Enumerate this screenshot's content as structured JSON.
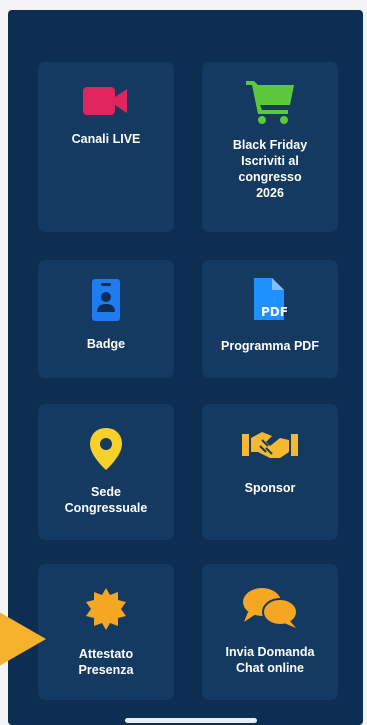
{
  "tiles": [
    {
      "label": "Canali LIVE",
      "icon": "video-camera-icon",
      "color": "#e0245e"
    },
    {
      "label": "Black Friday\nIscriviti al\ncongresso\n2026",
      "icon": "shopping-cart-icon",
      "color": "#5cc93a"
    },
    {
      "label": "Badge",
      "icon": "id-badge-icon",
      "color": "#1e7bf0"
    },
    {
      "label": "Programma PDF",
      "icon": "pdf-file-icon",
      "color": "#1e90ff"
    },
    {
      "label": "Sede\nCongressuale",
      "icon": "map-pin-icon",
      "color": "#f7d12a"
    },
    {
      "label": "Sponsor",
      "icon": "handshake-icon",
      "color": "#f5b82e"
    },
    {
      "label": "Attestato\nPresenza",
      "icon": "certificate-seal-icon",
      "color": "#f5a623"
    },
    {
      "label": "Invia Domanda\nChat online",
      "icon": "chat-bubbles-icon",
      "color": "#f5a623"
    }
  ],
  "pointer": {
    "icon": "arrow-pointer-icon",
    "color": "#f6b12d"
  },
  "colors": {
    "background": "#0c2e52",
    "tile": "#143a62"
  }
}
